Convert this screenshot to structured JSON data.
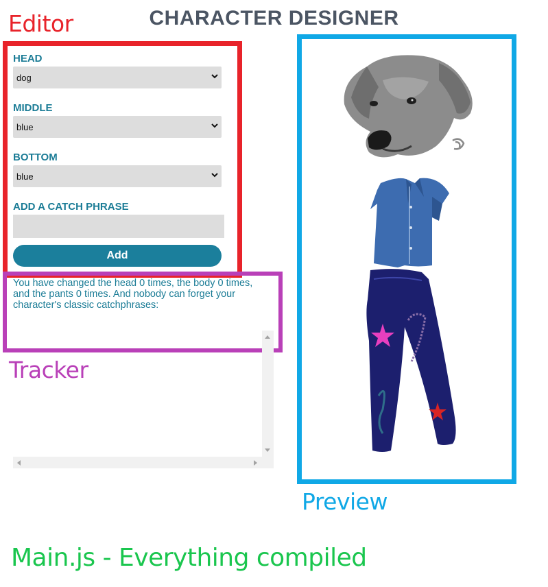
{
  "app_title": "CHARACTER DESIGNER",
  "annotations": {
    "editor": "Editor",
    "tracker": "Tracker",
    "preview": "Preview",
    "main": "Main.js - Everything compiled"
  },
  "editor": {
    "head_label": "HEAD",
    "head_value": "dog",
    "middle_label": "MIDDLE",
    "middle_value": "blue",
    "bottom_label": "BOTTOM",
    "bottom_value": "blue",
    "catch_label": "ADD A CATCH PHRASE",
    "catch_value": "",
    "add_label": "Add"
  },
  "tracker": {
    "text": "You have changed the head 0 times, the body 0 times, and the pants 0 times. And nobody can forget your character's classic catchphrases:"
  },
  "colors": {
    "editor_border": "#e8232a",
    "tracker_border": "#b940b8",
    "preview_border": "#10a8e6",
    "main_label": "#1ac64e",
    "accent": "#1b7f9c"
  },
  "icons": [
    "chevron-down-icon",
    "scroll-up-arrow",
    "scroll-down-arrow",
    "scroll-left-arrow",
    "scroll-right-arrow"
  ]
}
